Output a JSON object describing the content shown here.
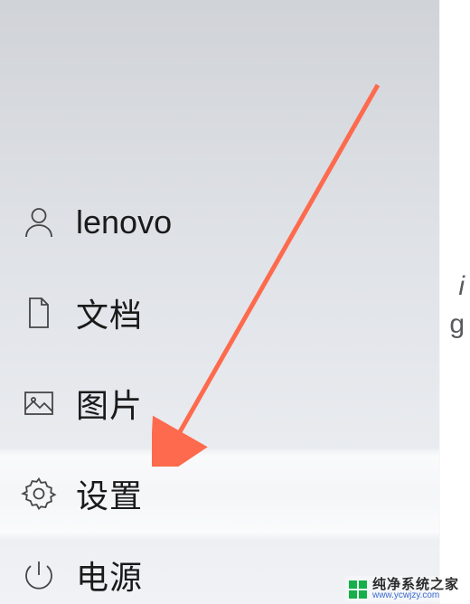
{
  "menu": {
    "user": {
      "icon": "person-icon",
      "label": "lenovo"
    },
    "documents": {
      "icon": "document-icon",
      "label": "文档"
    },
    "pictures": {
      "icon": "picture-icon",
      "label": "图片"
    },
    "settings": {
      "icon": "gear-icon",
      "label": "设置"
    },
    "power": {
      "icon": "power-icon",
      "label": "电源"
    }
  },
  "annotation": {
    "arrow_color": "#fd6a4d"
  },
  "watermark": {
    "title": "纯净系统之家",
    "url": "www.ycwjzy.com"
  },
  "stray": {
    "a": "i",
    "b": "g"
  }
}
